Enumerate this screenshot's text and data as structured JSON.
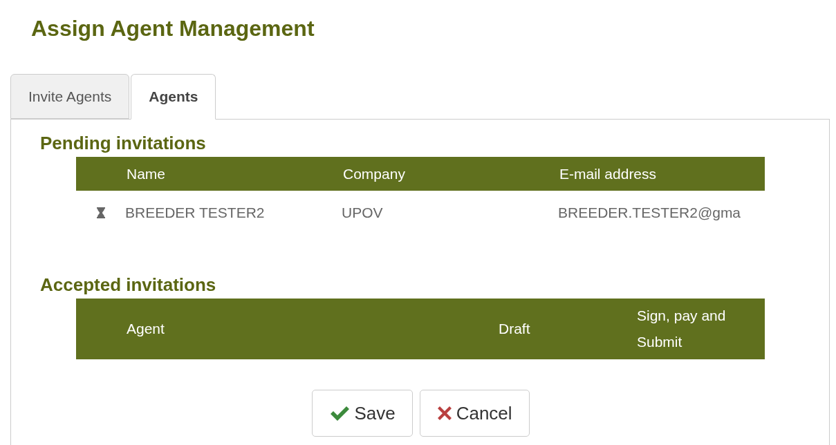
{
  "title": "Assign Agent Management",
  "tabs": [
    {
      "label": "Invite Agents",
      "selected": false
    },
    {
      "label": "Agents",
      "selected": true
    }
  ],
  "pending": {
    "heading": "Pending invitations",
    "columns": [
      "Name",
      "Company",
      "E-mail address"
    ],
    "rows": [
      {
        "kind": "pending",
        "cells": [
          "BREEDER TESTER2",
          "UPOV",
          "BREEDER.TESTER2@gma"
        ]
      }
    ]
  },
  "accepted": {
    "heading": "Accepted invitations",
    "columns": [
      "Agent",
      "Draft",
      "Sign, pay and Submit"
    ]
  },
  "buttons": [
    {
      "kind": "save",
      "label": "Save"
    },
    {
      "kind": "cancel",
      "label": "Cancel"
    }
  ]
}
